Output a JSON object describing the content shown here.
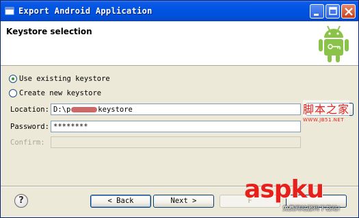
{
  "window": {
    "title": "Export Android Application",
    "title_icon": "dialog-icon",
    "controls": [
      "minimize-icon",
      "maximize-icon",
      "close-icon"
    ]
  },
  "banner": {
    "title": "Keystore selection",
    "logo": "android-robot-icon"
  },
  "options": {
    "use_existing": "Use existing keystore",
    "create_new": "Create new keystore",
    "selected": "use_existing"
  },
  "fields": {
    "location_label": "Location:",
    "location_value_prefix": "D:\\p",
    "location_value_suffix": "keystore",
    "password_label": "Password:",
    "password_value": "********",
    "confirm_label": "Confirm:",
    "confirm_value": ""
  },
  "buttons": {
    "help": "?",
    "back": "< Back",
    "back_mnemonic": "B",
    "next": "Next >",
    "next_mnemonic": "N",
    "finish": "F",
    "cancel": ""
  },
  "watermarks": {
    "top_right_cn": "脚本之家",
    "top_right_url": "WWW.JB51.NET",
    "bottom_right_brand": "aspku",
    "bottom_right_cn": "免费网站源码下载站!"
  },
  "colors": {
    "titlebar": "#0054e3",
    "dialog_bg": "#ece9d8",
    "android_green": "#8bc34a",
    "watermark_red": "#e8201c"
  }
}
